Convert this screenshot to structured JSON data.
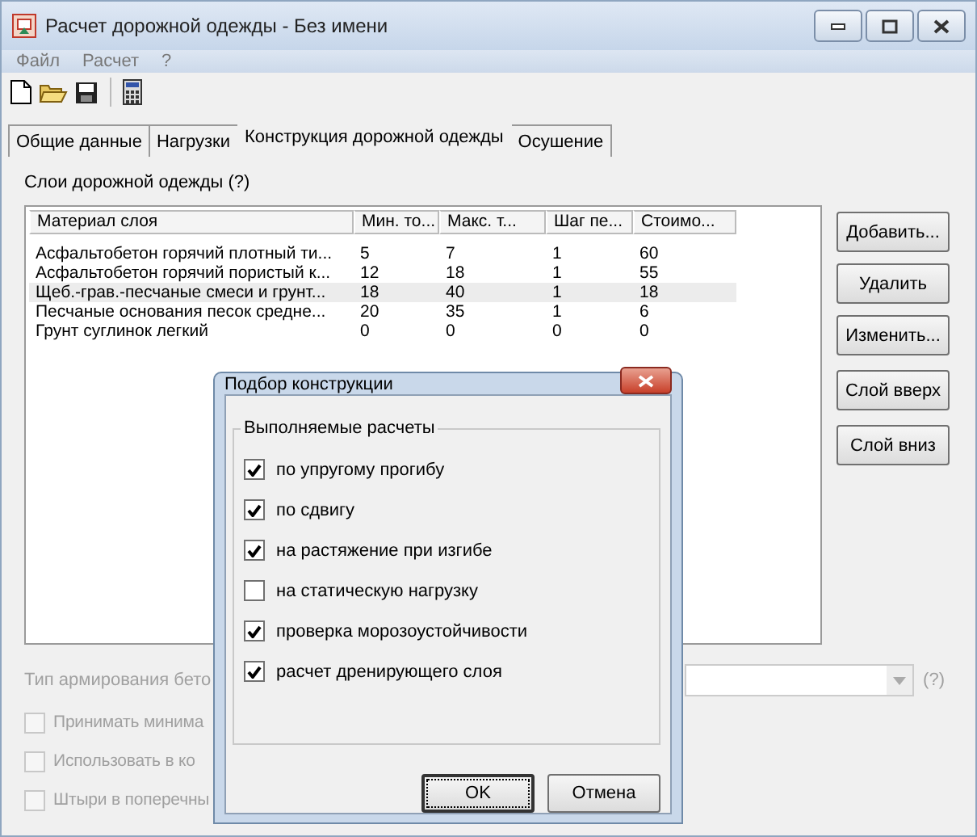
{
  "window": {
    "title": "Расчет дорожной одежды - Без имени"
  },
  "menu": [
    "Файл",
    "Расчет",
    "?"
  ],
  "tabs": [
    {
      "label": "Общие данные",
      "selected": false
    },
    {
      "label": "Нагрузки",
      "selected": false
    },
    {
      "label": "Конструкция дорожной одежды",
      "selected": true
    },
    {
      "label": "Осушение",
      "selected": false
    }
  ],
  "layers_label": "Слои дорожной одежды (?)",
  "table": {
    "columns": [
      "Материал слоя",
      "Мин. то...",
      "Макс. т...",
      "Шаг пе...",
      "Стоимо..."
    ],
    "rows": [
      {
        "cells": [
          "Асфальтобетон горячий плотный ти...",
          "5",
          "7",
          "1",
          "60"
        ],
        "selected": false
      },
      {
        "cells": [
          "Асфальтобетон горячий пористый к...",
          "12",
          "18",
          "1",
          "55"
        ],
        "selected": false
      },
      {
        "cells": [
          "Щеб.-грав.-песчаные смеси и грунт...",
          "18",
          "40",
          "1",
          "18"
        ],
        "selected": true
      },
      {
        "cells": [
          "Песчаные основания песок средне...",
          "20",
          "35",
          "1",
          "6"
        ],
        "selected": false
      },
      {
        "cells": [
          "Грунт суглинок легкий",
          "0",
          "0",
          "0",
          "0"
        ],
        "selected": false
      }
    ]
  },
  "side_buttons": [
    "Добавить...",
    "Удалить",
    "Изменить...",
    "Слой вверх",
    "Слой вниз"
  ],
  "reinforcement": {
    "label": "Тип армирования бето",
    "help": "(?)"
  },
  "options": [
    {
      "label": "Принимать минима",
      "checked": false
    },
    {
      "label": "Использовать в ко",
      "checked": false
    },
    {
      "label": "Штыри в поперечны",
      "checked": false
    }
  ],
  "dialog": {
    "title": "Подбор конструкции",
    "group": "Выполняемые расчеты",
    "checks": [
      {
        "label": "по упругому прогибу",
        "checked": true
      },
      {
        "label": "по сдвигу",
        "checked": true
      },
      {
        "label": "на растяжение при изгибе",
        "checked": true
      },
      {
        "label": "на статическую нагрузку",
        "checked": false
      },
      {
        "label": "проверка морозоустойчивости",
        "checked": true
      },
      {
        "label": "расчет дренирующего слоя",
        "checked": true
      }
    ],
    "ok": "OK",
    "cancel": "Отмена"
  }
}
